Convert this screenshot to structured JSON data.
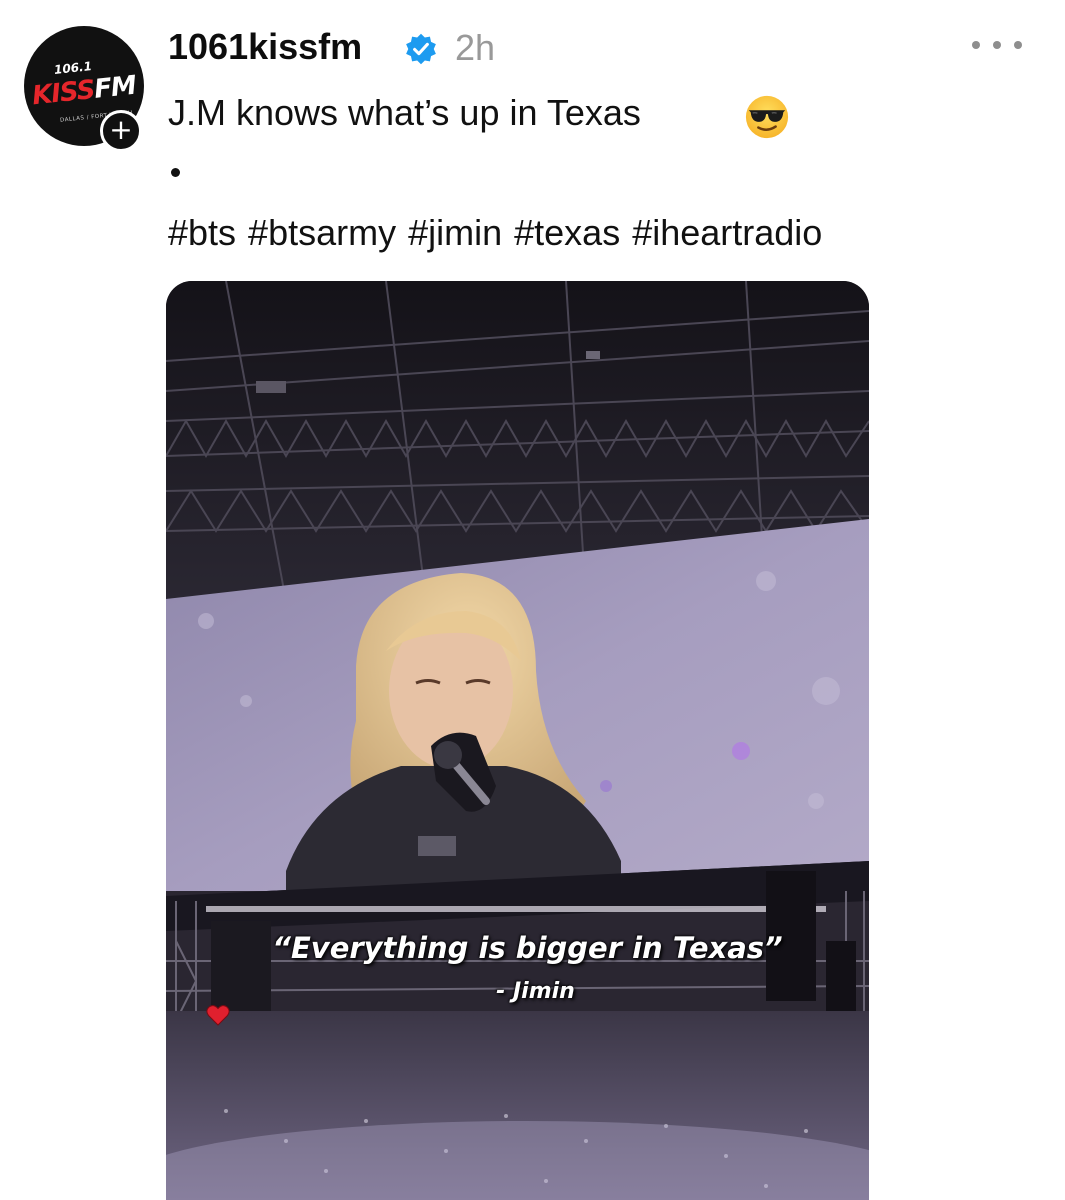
{
  "account": {
    "avatar": {
      "frequency": "106.1",
      "logo_part1": "KISS",
      "logo_part2": "FM",
      "market": "DALLAS / FORT WORTH"
    },
    "follow_symbol": "+",
    "username": "1061kissfm",
    "verified": true,
    "time": "2h"
  },
  "post": {
    "caption": "J.M knows what’s up in Texas",
    "caption_emoji": "smiling-face-with-sunglasses",
    "hashtags": [
      "#bts",
      "#btsarmy",
      "#jimin",
      "#texas",
      "#iheartradio"
    ]
  },
  "media": {
    "quote": "“Everything is bigger in Texas”",
    "attribution": "- Jimin",
    "attribution_icon": "red-heart"
  },
  "colors": {
    "text": "#111111",
    "muted": "#999999",
    "verified_blue": "#1d9bf0",
    "kiss_red": "#e5262b",
    "screen_lavender": "#a79ec0"
  }
}
